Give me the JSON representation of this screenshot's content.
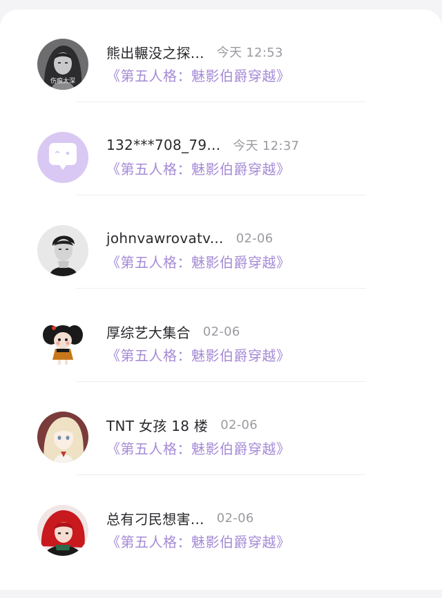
{
  "messages": [
    {
      "name": "熊出輾没之探...",
      "time": "今天 12:53",
      "book": "《第五人格：魅影伯爵穿越》",
      "avatar_caption": "伤痕太深",
      "avatar_icon": "girl-portrait"
    },
    {
      "name": "132***708_79...",
      "time": "今天 12:37",
      "book": "《第五人格：魅影伯爵穿越》",
      "avatar_icon": "chat-bubble-icon"
    },
    {
      "name": "johnvawrovatv...",
      "time": "02-06",
      "book": "《第五人格：魅影伯爵穿越》",
      "avatar_icon": "man-portrait"
    },
    {
      "name": "厚综艺大集合",
      "time": "02-06",
      "book": "《第五人格：魅影伯爵穿越》",
      "avatar_icon": "cartoon-doll"
    },
    {
      "name": "TNT 女孩 18 楼",
      "time": "02-06",
      "book": "《第五人格：魅影伯爵穿越》",
      "avatar_icon": "anime-girl"
    },
    {
      "name": "总有刁民想害...",
      "time": "02-06",
      "book": "《第五人格：魅影伯爵穿越》",
      "avatar_icon": "red-anime-character"
    }
  ],
  "colors": {
    "accent": "#a58ad6",
    "placeholder_avatar": "#d9c8f3"
  }
}
